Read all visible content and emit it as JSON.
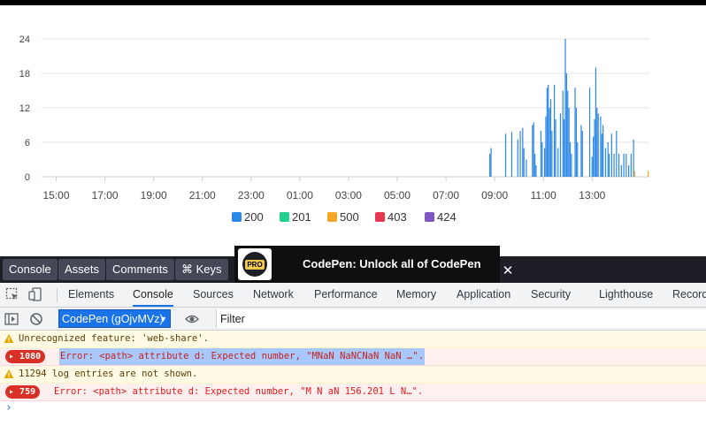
{
  "chart_data": {
    "type": "bar",
    "x_ticks": [
      "15:00",
      "17:00",
      "19:00",
      "21:00",
      "23:00",
      "01:00",
      "03:00",
      "05:00",
      "07:00",
      "09:00",
      "11:00",
      "13:00"
    ],
    "y_ticks": [
      0,
      6,
      12,
      18,
      24
    ],
    "ylim": [
      0,
      24
    ],
    "grid": true,
    "legend_position": "bottom",
    "x_unit": "hours since 15:00",
    "series": [
      {
        "name": "200",
        "color": "#2b87e8",
        "points": [
          [
            17.8,
            4
          ],
          [
            17.85,
            5
          ],
          [
            18.45,
            7.5
          ],
          [
            18.7,
            7.8
          ],
          [
            18.95,
            6.5
          ],
          [
            19.05,
            8
          ],
          [
            19.15,
            8.5
          ],
          [
            19.2,
            5
          ],
          [
            19.3,
            3
          ],
          [
            19.55,
            9
          ],
          [
            19.6,
            9.5
          ],
          [
            19.65,
            4
          ],
          [
            19.7,
            2
          ],
          [
            19.9,
            8
          ],
          [
            19.95,
            6
          ],
          [
            20.05,
            5
          ],
          [
            20.1,
            10.5
          ],
          [
            20.15,
            15.5
          ],
          [
            20.2,
            16
          ],
          [
            20.25,
            12
          ],
          [
            20.3,
            13.5
          ],
          [
            20.35,
            8
          ],
          [
            20.45,
            16
          ],
          [
            20.5,
            10
          ],
          [
            20.6,
            5
          ],
          [
            20.7,
            11
          ],
          [
            20.8,
            15
          ],
          [
            20.85,
            10
          ],
          [
            20.9,
            24
          ],
          [
            20.95,
            18
          ],
          [
            21.0,
            15
          ],
          [
            21.05,
            12
          ],
          [
            21.1,
            6
          ],
          [
            21.15,
            4
          ],
          [
            21.3,
            15.5
          ],
          [
            21.35,
            12
          ],
          [
            21.4,
            6
          ],
          [
            21.55,
            9
          ],
          [
            21.6,
            8
          ],
          [
            21.9,
            15.5
          ],
          [
            22.0,
            3.5
          ],
          [
            22.05,
            7
          ],
          [
            22.1,
            10
          ],
          [
            22.15,
            19
          ],
          [
            22.2,
            12
          ],
          [
            22.25,
            11
          ],
          [
            22.35,
            10.5
          ],
          [
            22.4,
            7.5
          ],
          [
            22.45,
            9
          ],
          [
            22.55,
            5
          ],
          [
            22.65,
            6
          ],
          [
            22.7,
            4
          ],
          [
            22.8,
            7.5
          ],
          [
            22.9,
            4
          ],
          [
            23.0,
            8
          ],
          [
            23.1,
            4
          ],
          [
            23.2,
            2
          ],
          [
            23.3,
            4
          ],
          [
            23.4,
            4
          ],
          [
            23.5,
            2
          ],
          [
            23.6,
            4
          ],
          [
            23.7,
            6.5
          ]
        ]
      },
      {
        "name": "201",
        "color": "#22d18b",
        "points": []
      },
      {
        "name": "500",
        "color": "#f5a623",
        "points": [
          [
            23.75,
            1
          ],
          [
            24.3,
            1
          ]
        ]
      },
      {
        "name": "403",
        "color": "#e8384f",
        "points": []
      },
      {
        "name": "424",
        "color": "#7e57c2",
        "points": []
      }
    ]
  },
  "codepen_bar": {
    "buttons": [
      "Console",
      "Assets",
      "Comments",
      "⌘ Keys"
    ],
    "pro_badge": "PRO",
    "pro_text": "CodePen: Unlock all of CodePen",
    "close": "✕"
  },
  "devtools": {
    "tabs": [
      "Elements",
      "Console",
      "Sources",
      "Network",
      "Performance",
      "Memory",
      "Application",
      "Security",
      "Lighthouse",
      "Record"
    ],
    "active_tab": "Console",
    "context": "CodePen (gOjvMVz)",
    "filter_placeholder": "Filter"
  },
  "console": {
    "messages": [
      {
        "level": "warning",
        "text": "Unrecognized feature: 'web-share'."
      },
      {
        "level": "error",
        "count": "1080",
        "text": "Error: <path> attribute d: Expected number, \"MNaN NaNCNaN NaN …\"."
      },
      {
        "level": "warning",
        "text": "11294 log entries are not shown."
      },
      {
        "level": "error",
        "count": "759",
        "text": "Error: <path> attribute d: Expected number, \"M N aN 156.201 L N…\"."
      }
    ],
    "prompt": "›"
  }
}
